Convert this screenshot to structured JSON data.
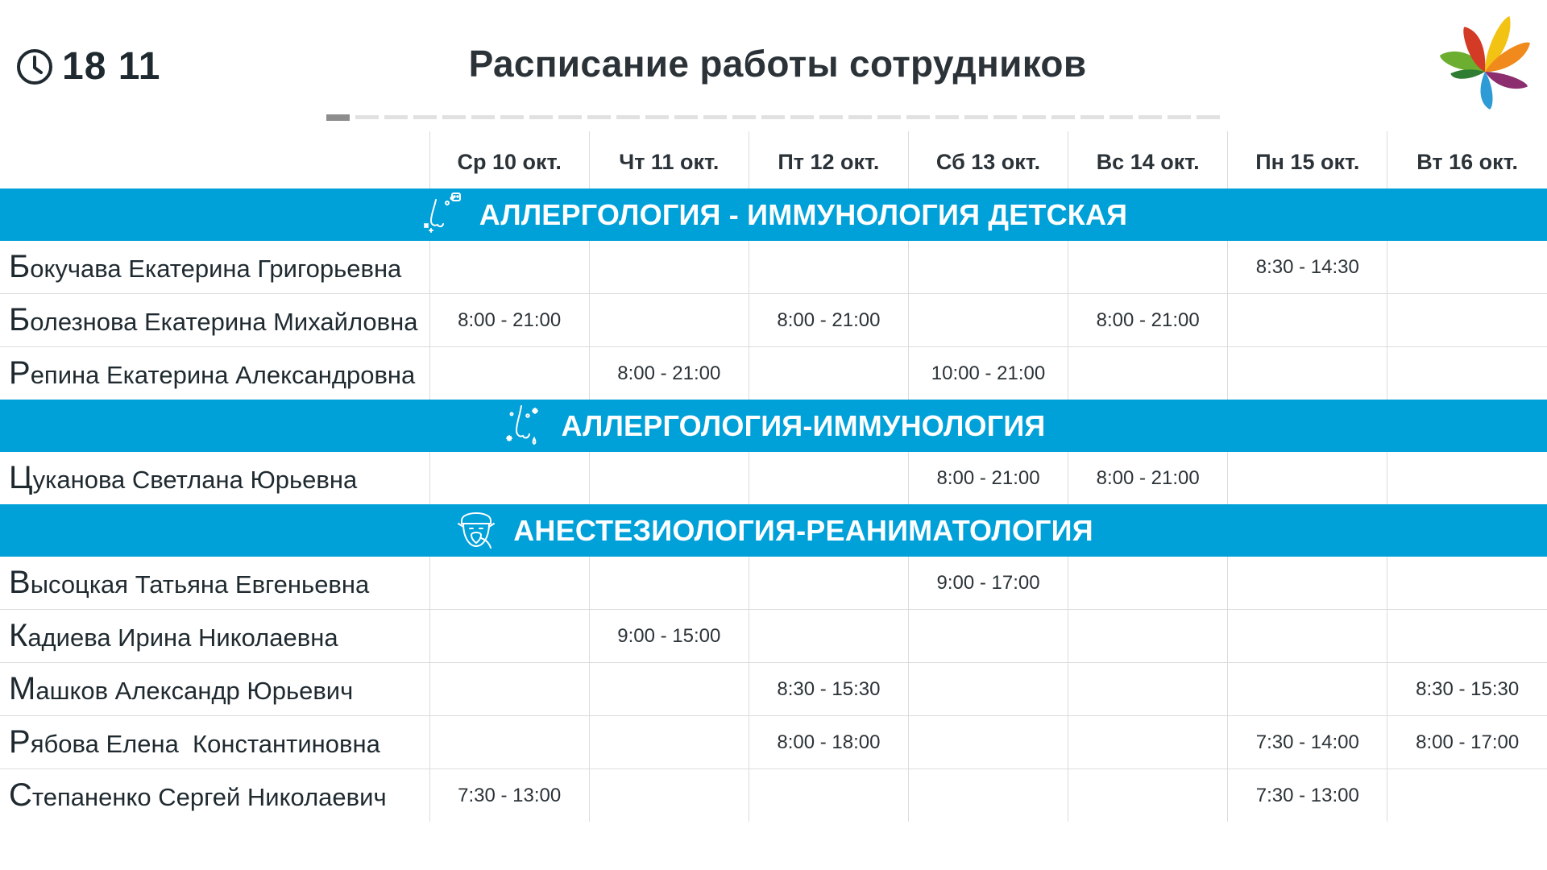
{
  "header": {
    "time": "18 11",
    "title": "Расписание работы сотрудников"
  },
  "pager": {
    "total": 31,
    "active_index": 0
  },
  "days": [
    "Ср 10 окт.",
    "Чт 11 окт.",
    "Пт 12 окт.",
    "Сб 13 окт.",
    "Вс 14 окт.",
    "Пн 15 окт.",
    "Вт 16 окт."
  ],
  "sections": [
    {
      "title": "АЛЛЕРГОЛОГИЯ - ИММУНОЛОГИЯ ДЕТСКАЯ",
      "icon": "child-allergy-icon",
      "rows": [
        {
          "first": "Б",
          "rest": "окучава Екатерина Григорьевна",
          "shifts": [
            "",
            "",
            "",
            "",
            "",
            "8:30 - 14:30",
            ""
          ]
        },
        {
          "first": "Б",
          "rest": "олезнова Екатерина Михайловна",
          "shifts": [
            "8:00 - 21:00",
            "",
            "8:00 - 21:00",
            "",
            "8:00 - 21:00",
            "",
            ""
          ]
        },
        {
          "first": "Р",
          "rest": "епина Екатерина Александровна",
          "shifts": [
            "",
            "8:00 - 21:00",
            "",
            "10:00 - 21:00",
            "",
            "",
            ""
          ]
        }
      ]
    },
    {
      "title": "АЛЛЕРГОЛОГИЯ-ИММУНОЛОГИЯ",
      "icon": "allergy-nose-icon",
      "rows": [
        {
          "first": "Ц",
          "rest": "уканова Светлана Юрьевна",
          "shifts": [
            "",
            "",
            "",
            "8:00 - 21:00",
            "8:00 - 21:00",
            "",
            ""
          ]
        }
      ]
    },
    {
      "title": "АНЕСТЕЗИОЛОГИЯ-РЕАНИМАТОЛОГИЯ",
      "icon": "anesthesia-mask-icon",
      "rows": [
        {
          "first": "В",
          "rest": "ысоцкая Татьяна Евгеньевна",
          "shifts": [
            "",
            "",
            "",
            "9:00 - 17:00",
            "",
            "",
            ""
          ]
        },
        {
          "first": "К",
          "rest": "адиева Ирина Николаевна",
          "shifts": [
            "",
            "9:00 - 15:00",
            "",
            "",
            "",
            "",
            ""
          ]
        },
        {
          "first": "М",
          "rest": "ашков Александр Юрьевич",
          "shifts": [
            "",
            "",
            "8:30 - 15:30",
            "",
            "",
            "",
            "8:30 - 15:30"
          ]
        },
        {
          "first": "Р",
          "rest": "ябова Елена  Константиновна",
          "shifts": [
            "",
            "",
            "8:00 - 18:00",
            "",
            "",
            "7:30 - 14:00",
            "8:00 - 17:00"
          ]
        },
        {
          "first": "С",
          "rest": "тепаненко Сергей Николаевич",
          "shifts": [
            "7:30 - 13:00",
            "",
            "",
            "",
            "",
            "7:30 - 13:00",
            ""
          ]
        }
      ]
    }
  ],
  "colors": {
    "section_bg": "#00a0d8",
    "text": "#1f2a30",
    "grid": "#dcdcdc",
    "pager_active": "#8d8d8d",
    "pager_inactive": "#e1e1e1"
  }
}
